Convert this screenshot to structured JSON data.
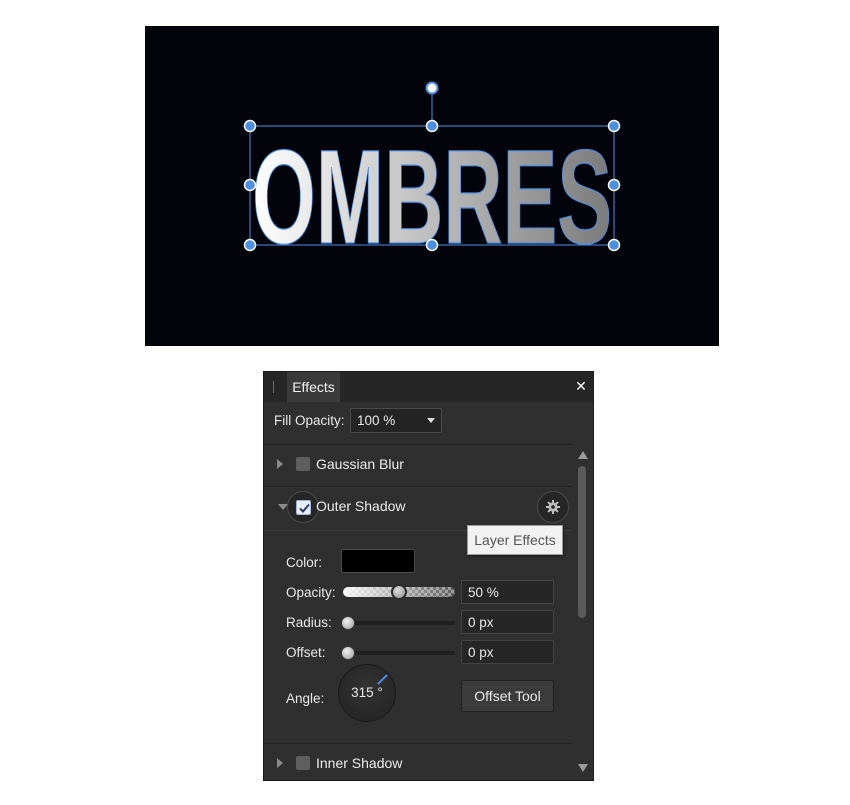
{
  "canvas": {
    "background": "#02030b",
    "artwork_text": "OMBRES",
    "selection_color": "#4a8fe3"
  },
  "panel": {
    "tab_label": "Effects",
    "close_icon": "✕",
    "fill_opacity": {
      "label": "Fill Opacity:",
      "value": "100 %"
    },
    "effects": [
      {
        "name": "Gaussian Blur",
        "checked": false,
        "expanded": false
      },
      {
        "name": "Outer Shadow",
        "checked": true,
        "expanded": true
      },
      {
        "name": "Inner Shadow",
        "checked": false,
        "expanded": false
      }
    ],
    "outer_shadow": {
      "color_label": "Color:",
      "color_value": "#000000",
      "opacity_label": "Opacity:",
      "opacity_value": "50 %",
      "opacity_fraction": 0.5,
      "radius_label": "Radius:",
      "radius_value": "0 px",
      "offset_label": "Offset:",
      "offset_value": "0 px",
      "angle_label": "Angle:",
      "angle_value": "315 °",
      "angle_degrees": 315,
      "offset_tool_label": "Offset Tool"
    },
    "tooltip": "Layer Effects"
  }
}
